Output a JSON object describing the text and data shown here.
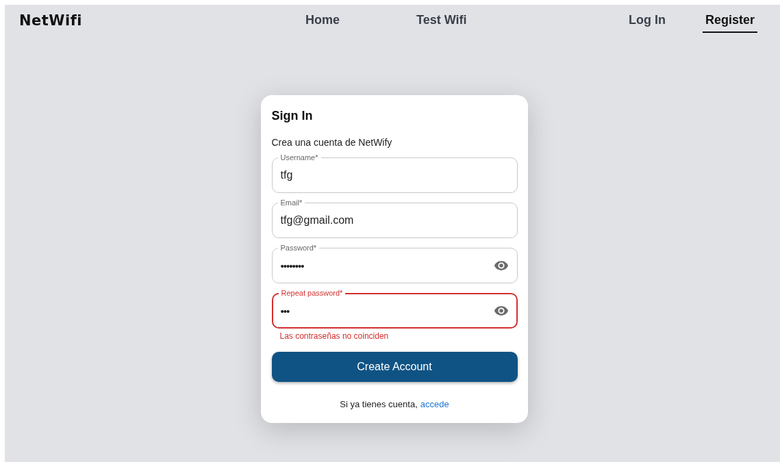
{
  "header": {
    "logo": "NetWifi",
    "nav": [
      {
        "label": "Home",
        "selected": false
      },
      {
        "label": "Test Wifi",
        "selected": false
      }
    ],
    "account_nav": [
      {
        "label": "Log In",
        "selected": false
      },
      {
        "label": "Register",
        "selected": true
      }
    ]
  },
  "card": {
    "title": "Sign In",
    "subtitle": "Crea una cuenta de NetWify",
    "fields": [
      {
        "label": "Username*",
        "value": "tfg",
        "kind": "text",
        "error": false
      },
      {
        "label": "Email*",
        "value": "tfg@gmail.com",
        "kind": "text",
        "error": false
      },
      {
        "label": "Password*",
        "value": "••••••••",
        "kind": "password",
        "error": false
      },
      {
        "label": "Repeat password*",
        "value": "•••",
        "kind": "password",
        "error": true,
        "helper_text": "Las contraseñas no coinciden"
      }
    ],
    "submit": "Create Account",
    "footer": {
      "text": "Si ya tienes cuenta,",
      "link": "accede"
    }
  }
}
